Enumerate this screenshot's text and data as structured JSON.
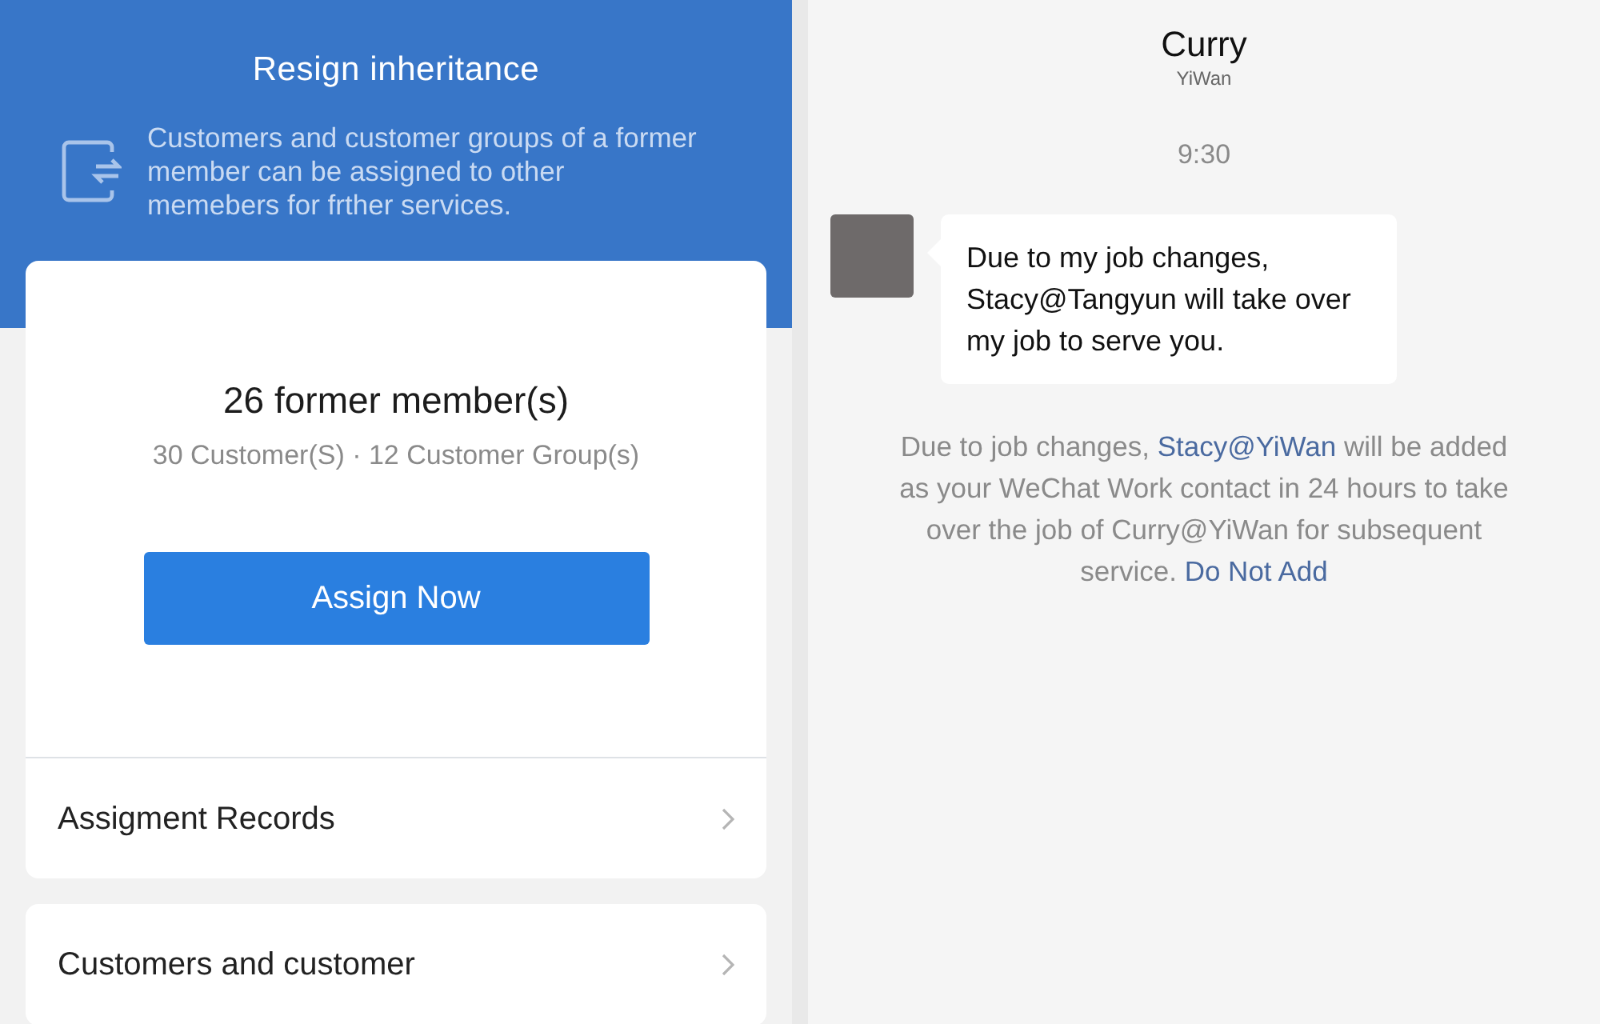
{
  "inheritance": {
    "title": "Resign inheritance",
    "description": "Customers and customer groups of a former member can be assigned to other memebers for frther services.",
    "summary": {
      "title": "26 former member(s)",
      "stats": "30 Customer(S) · 12 Customer Group(s)",
      "button": "Assign Now"
    },
    "menu_items": [
      {
        "label": "Assigment Records"
      },
      {
        "label": "Customers and customer"
      }
    ]
  },
  "chat": {
    "contact": {
      "name": "Curry",
      "org": "YiWan"
    },
    "time": "9:30",
    "message": {
      "text": "Due to my job changes, Stacy@Tangyun will take over my job to serve you."
    },
    "notice": [
      {
        "kind": "text",
        "text": "Due to job changes, "
      },
      {
        "kind": "link",
        "text": "Stacy@YiWan"
      },
      {
        "kind": "text",
        "text": " will be added as your WeChat Work contact in 24 hours to take over the job of Curry@YiWan for subsequent service. "
      },
      {
        "kind": "link",
        "text": "Do Not Add"
      }
    ]
  }
}
